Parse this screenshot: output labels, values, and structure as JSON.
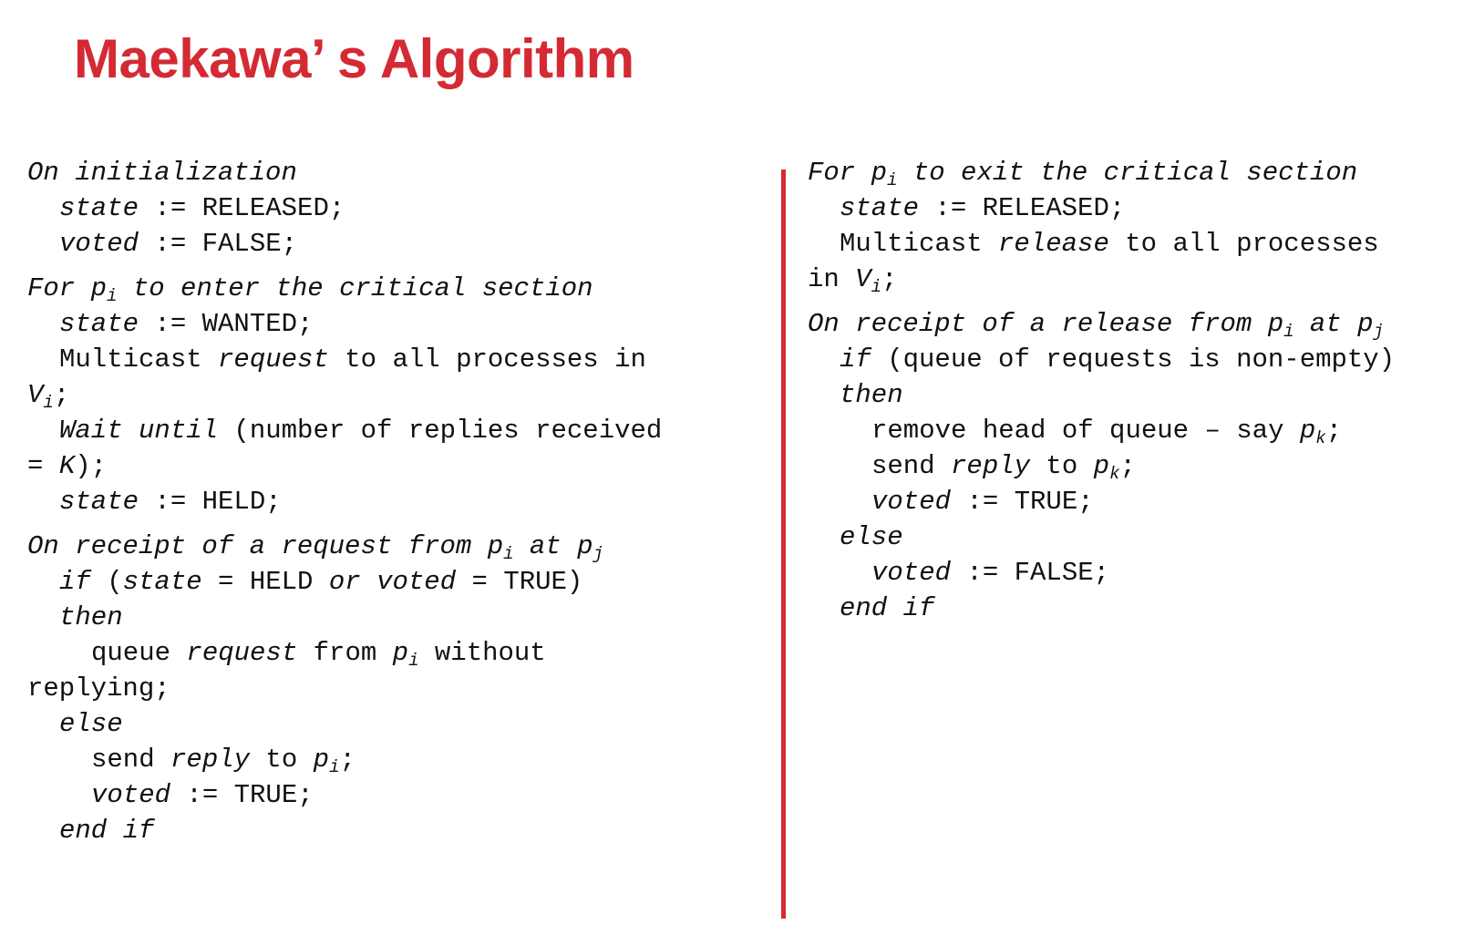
{
  "title": "Maekawa’ s Algorithm",
  "colors": {
    "accent": "#d42a34",
    "text": "#111111",
    "background": "#ffffff"
  },
  "left": {
    "init": {
      "header": "On initialization",
      "state_var": "state",
      "state_val": ":= RELEASED;",
      "voted_var": "voted",
      "voted_val": ":= FALSE;"
    },
    "enter": {
      "header_a": "For ",
      "header_p": "p",
      "header_sub": "i",
      "header_b": " to enter the critical section",
      "state_var": "state",
      "state_val": ":= WANTED;",
      "multicast_a": "Multicast ",
      "multicast_req": "request",
      "multicast_b": " to all processes in",
      "v": "V",
      "v_sub": "i",
      "v_end": ";",
      "wait": "Wait until",
      "wait_rest": " (number of replies received",
      "eq": "= ",
      "k": "K",
      "k_end": ");",
      "held_var": "state",
      "held_val": ":= HELD;"
    },
    "receipt": {
      "header_a": "On receipt of a request from ",
      "p": "p",
      "p_sub": "i",
      "at": " at ",
      "pj": "p",
      "pj_sub": "j",
      "if_kw": "if",
      "if_a": " (",
      "if_state": "state",
      "if_b": " = HELD ",
      "if_or": "or voted",
      "if_c": " = TRUE)",
      "then": "then",
      "queue_a": "queue ",
      "queue_req": "request",
      "queue_b": " from ",
      "queue_p": "p",
      "queue_sub": "i",
      "queue_c": " without",
      "replying": "replying;",
      "else": "else",
      "send_a": "send ",
      "send_reply": "reply",
      "send_b": " to ",
      "send_p": "p",
      "send_sub": "i",
      "send_end": ";",
      "voted_var": "voted",
      "voted_val": ":= TRUE;",
      "endif": "end if"
    }
  },
  "right": {
    "exit": {
      "header_a": "For ",
      "header_p": "p",
      "header_sub": "i",
      "header_b": " to exit the critical section",
      "state_var": "state",
      "state_val": ":= RELEASED;",
      "multicast_a": "Multicast ",
      "multicast_rel": "release",
      "multicast_b": " to all processes",
      "in_a": "in ",
      "v": "V",
      "v_sub": "i",
      "v_end": ";"
    },
    "release": {
      "header_a": "On receipt of a release from ",
      "p": "p",
      "p_sub": "i",
      "at": " at ",
      "pj": "p",
      "pj_sub": "j",
      "if_kw": "if",
      "if_rest": " (queue of requests is non-empty)",
      "then": "then",
      "remove_a": "remove head of queue – say ",
      "remove_p": "p",
      "remove_sub": "k",
      "remove_end": ";",
      "send_a": "send ",
      "send_reply": "reply",
      "send_b": " to ",
      "send_p": "p",
      "send_sub": "k",
      "send_end": ";",
      "voted_var": "voted",
      "voted_val": ":= TRUE;",
      "else": "else",
      "else_voted_var": "voted",
      "else_voted_val": ":= FALSE;",
      "endif": "end if"
    }
  }
}
